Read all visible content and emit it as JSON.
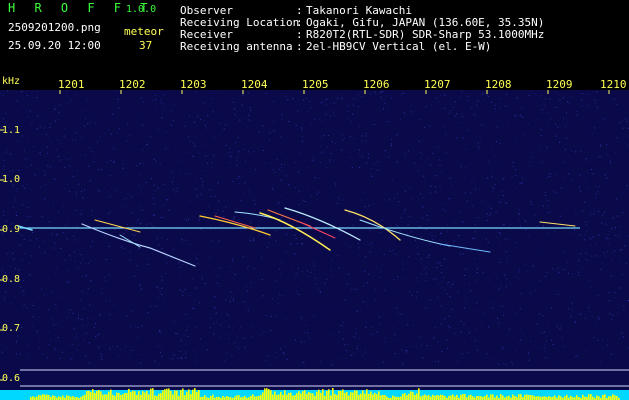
{
  "app": {
    "name": "H R O F F T",
    "version": "1.0.0"
  },
  "file": {
    "name": "2509201200.png",
    "datetime": "25.09.20 12:00"
  },
  "meteor": {
    "label": "meteor",
    "count": "37"
  },
  "info": [
    {
      "label": "Observer",
      "sep": ":",
      "value": "Takanori Kawachi"
    },
    {
      "label": "Receiving Location",
      "sep": ":",
      "value": "Ogaki, Gifu, JAPAN (136.60E, 35.35N)"
    },
    {
      "label": "Receiver",
      "sep": ":",
      "value": "R820T2(RTL-SDR) SDR-Sharp 53.1000MHz"
    },
    {
      "label": "Receiving antenna",
      "sep": ":",
      "value": "2el-HB9CV Vertical (el. E-W)"
    }
  ],
  "axis": {
    "y_unit": "kHz",
    "y_ticks": [
      "1.1",
      "1.0",
      "0.9",
      "0.8",
      "0.7",
      "0.6"
    ],
    "x_ticks": [
      "1201",
      "1202",
      "1203",
      "1204",
      "1205",
      "1206",
      "1207",
      "1208",
      "1209",
      "1210"
    ]
  },
  "colors": {
    "background": "#0a0a4a",
    "header_text": "#ffff55",
    "title_text": "#3cff3c",
    "carrier": "#7ad7ff",
    "bottom_bars": "#ffff00",
    "bottom_fill": "#00d8ff"
  }
}
